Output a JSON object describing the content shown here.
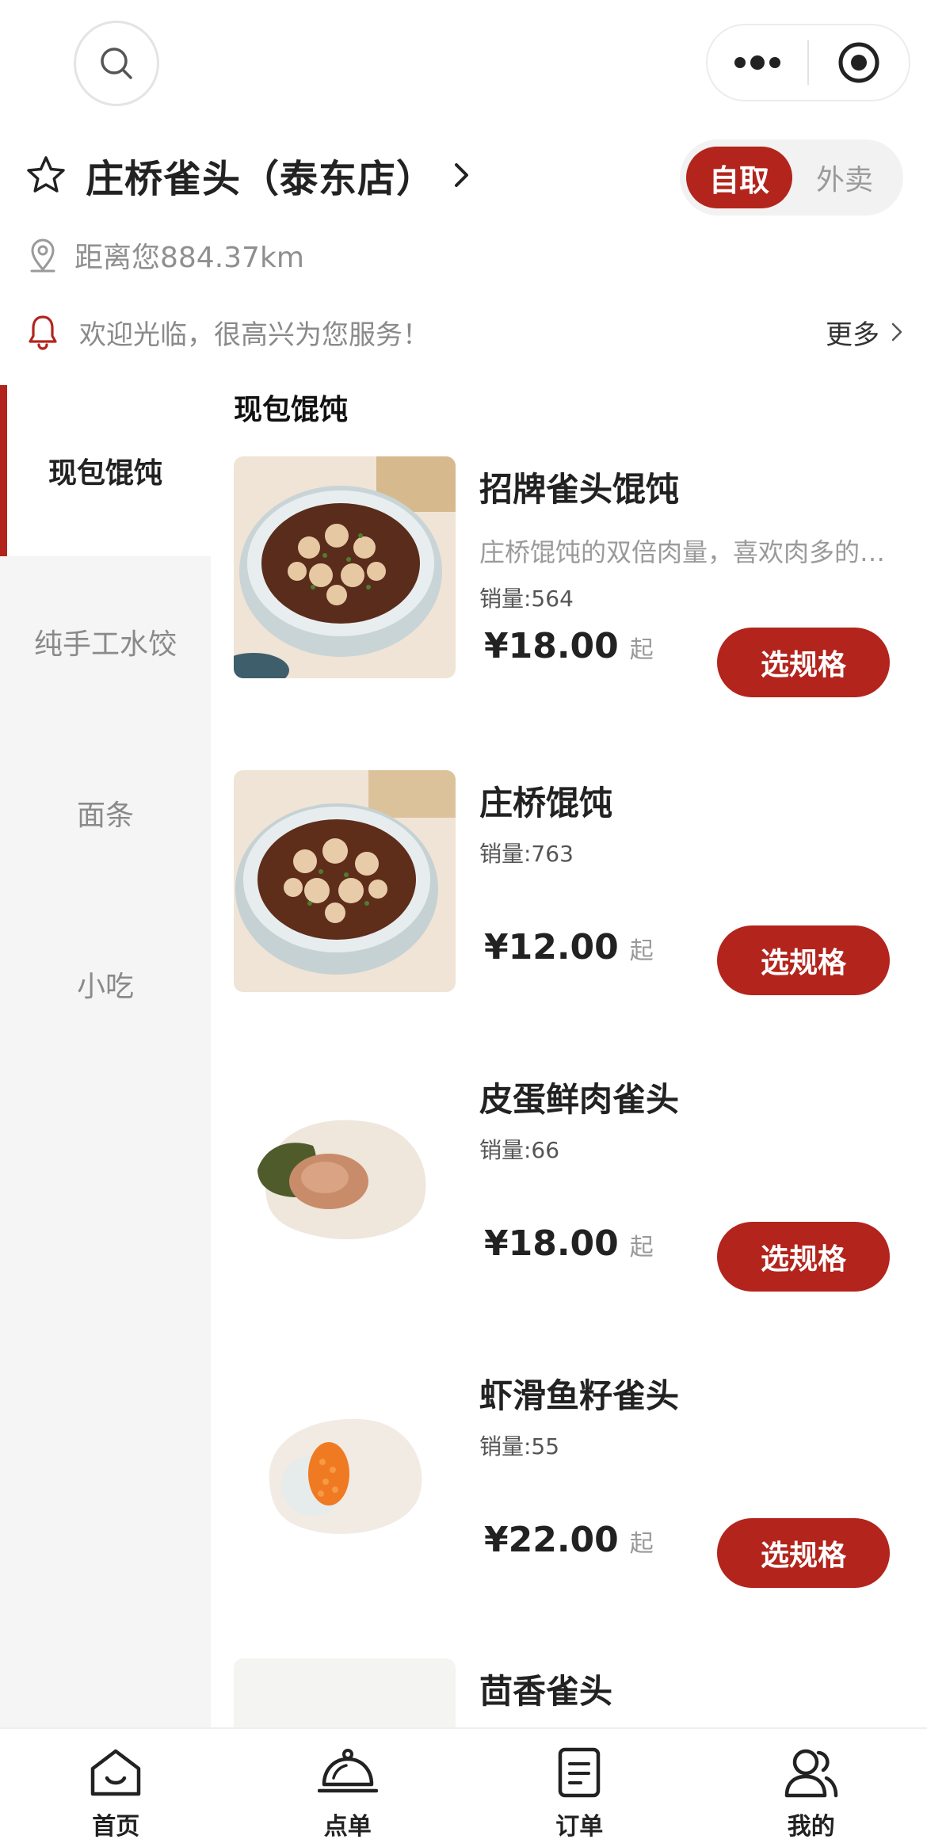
{
  "header": {
    "store_name": "庄桥雀头（泰东店）",
    "mode_active": "自取",
    "mode_inactive": "外卖",
    "distance": "距离您884.37km",
    "notice": "欢迎光临，很高兴为您服务！",
    "notice_more": "更多"
  },
  "sidebar": {
    "categories": [
      {
        "label": "现包馄饨",
        "active": true
      },
      {
        "label": "纯手工水饺",
        "active": false
      },
      {
        "label": "面条",
        "active": false
      },
      {
        "label": "小吃",
        "active": false
      }
    ]
  },
  "menu": {
    "section_title": "现包馄饨",
    "spec_button_label": "选规格",
    "price_suffix": "起",
    "items": [
      {
        "name": "招牌雀头馄饨",
        "desc": "庄桥馄饨的双倍肉量，喜欢肉多的朋友选它",
        "sales": "销量:564",
        "price": "¥18.00"
      },
      {
        "name": "庄桥馄饨",
        "desc": "",
        "sales": "销量:763",
        "price": "¥12.00"
      },
      {
        "name": "皮蛋鲜肉雀头",
        "desc": "",
        "sales": "销量:66",
        "price": "¥18.00"
      },
      {
        "name": "虾滑鱼籽雀头",
        "desc": "",
        "sales": "销量:55",
        "price": "¥22.00"
      },
      {
        "name": "茴香雀头",
        "desc": "",
        "sales": "",
        "price": ""
      }
    ]
  },
  "tabbar": {
    "tabs": [
      {
        "label": "首页",
        "icon": "home-icon"
      },
      {
        "label": "点单",
        "icon": "cloche-icon"
      },
      {
        "label": "订单",
        "icon": "order-icon"
      },
      {
        "label": "我的",
        "icon": "profile-icon"
      }
    ]
  },
  "colors": {
    "accent": "#b3241c",
    "sidebar_bg": "#f5f5f5"
  }
}
